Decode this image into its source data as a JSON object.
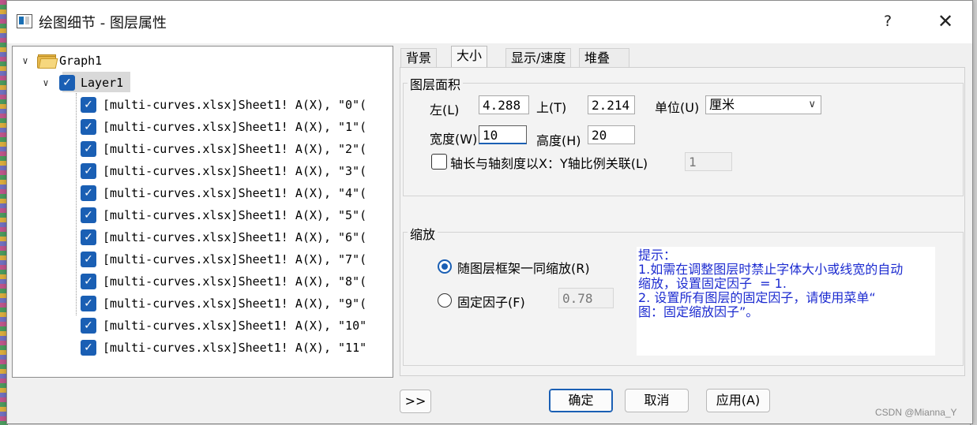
{
  "dialog": {
    "title": "绘图细节 - 图层属性",
    "help": "?",
    "close": "✕"
  },
  "tree": {
    "graph_label": "Graph1",
    "layer_label": "Layer1",
    "items": [
      "[multi-curves.xlsx]Sheet1! A(X), \"0\"(",
      "[multi-curves.xlsx]Sheet1! A(X), \"1\"(",
      "[multi-curves.xlsx]Sheet1! A(X), \"2\"(",
      "[multi-curves.xlsx]Sheet1! A(X), \"3\"(",
      "[multi-curves.xlsx]Sheet1! A(X), \"4\"(",
      "[multi-curves.xlsx]Sheet1! A(X), \"5\"(",
      "[multi-curves.xlsx]Sheet1! A(X), \"6\"(",
      "[multi-curves.xlsx]Sheet1! A(X), \"7\"(",
      "[multi-curves.xlsx]Sheet1! A(X), \"8\"(",
      "[multi-curves.xlsx]Sheet1! A(X), \"9\"(",
      "[multi-curves.xlsx]Sheet1! A(X), \"10\"",
      "[multi-curves.xlsx]Sheet1! A(X), \"11\""
    ]
  },
  "tabs": [
    "背景",
    "大小",
    "显示/速度",
    "堆叠"
  ],
  "active_tab": "大小",
  "area_group": {
    "title": "图层面积",
    "left_label": "左(L)",
    "left_value": "4.288",
    "top_label": "上(T)",
    "top_value": "2.214",
    "unit_label": "单位(U)",
    "unit_value": "厘米",
    "width_label": "宽度(W)",
    "width_value": "10",
    "height_label": "高度(H)",
    "height_value": "20",
    "link_checkbox_label": "轴长与轴刻度以X：Y轴比例关联(L)",
    "link_checkbox_checked": false,
    "ratio_value": "1"
  },
  "scale_group": {
    "title": "缩放",
    "option1_label": "随图层框架一同缩放(R)",
    "option1_selected": true,
    "option2_label": "固定因子(F)",
    "option2_selected": false,
    "factor_value": "0.78",
    "hint_lines": [
      "提示：",
      "1.如需在调整图层时禁止字体大小或线宽的自动",
      "缩放，设置固定因子  = 1.",
      "",
      "2. 设置所有图层的固定因子，请使用菜单“",
      "图：固定缩放因子”。"
    ]
  },
  "footer": {
    "expand_button": ">>",
    "ok": "确定",
    "cancel": "取消",
    "apply": "应用(A)"
  },
  "watermark": "CSDN @Mianna_Y",
  "colors": {
    "accent": "#1a5fb4",
    "hint_text": "#1c2bd0"
  }
}
